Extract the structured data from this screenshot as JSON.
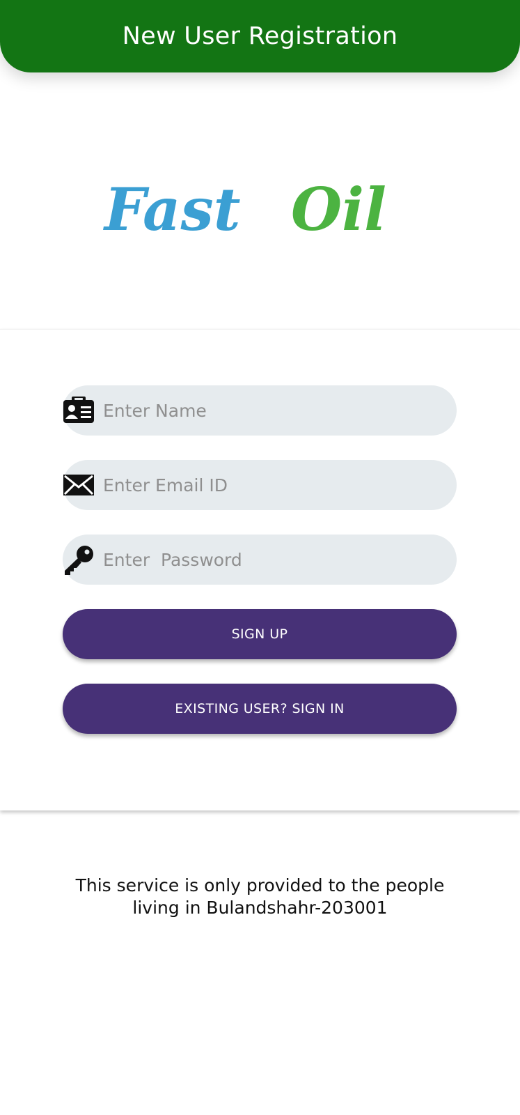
{
  "app_bar": {
    "title": "New User Registration",
    "color": "#137514"
  },
  "logo": {
    "part1": "Fast",
    "part2": "Oil",
    "part1_color": "#3b9fd3",
    "part2_color": "#4cb341"
  },
  "form": {
    "name_field": {
      "placeholder": "Enter Name",
      "value": "",
      "icon": "contact-card-icon"
    },
    "email_field": {
      "placeholder": "Enter Email ID",
      "value": "",
      "icon": "envelope-icon"
    },
    "password_field": {
      "placeholder": "Enter  Password",
      "value": "",
      "icon": "key-icon"
    },
    "signup_label": "SIGN UP",
    "signin_label": "EXISTING USER? SIGN IN",
    "button_color": "#473177",
    "field_color": "#e6ebee"
  },
  "footer": {
    "line1": "This service is only provided to the people",
    "line2": "living in Bulandshahr-203001"
  }
}
